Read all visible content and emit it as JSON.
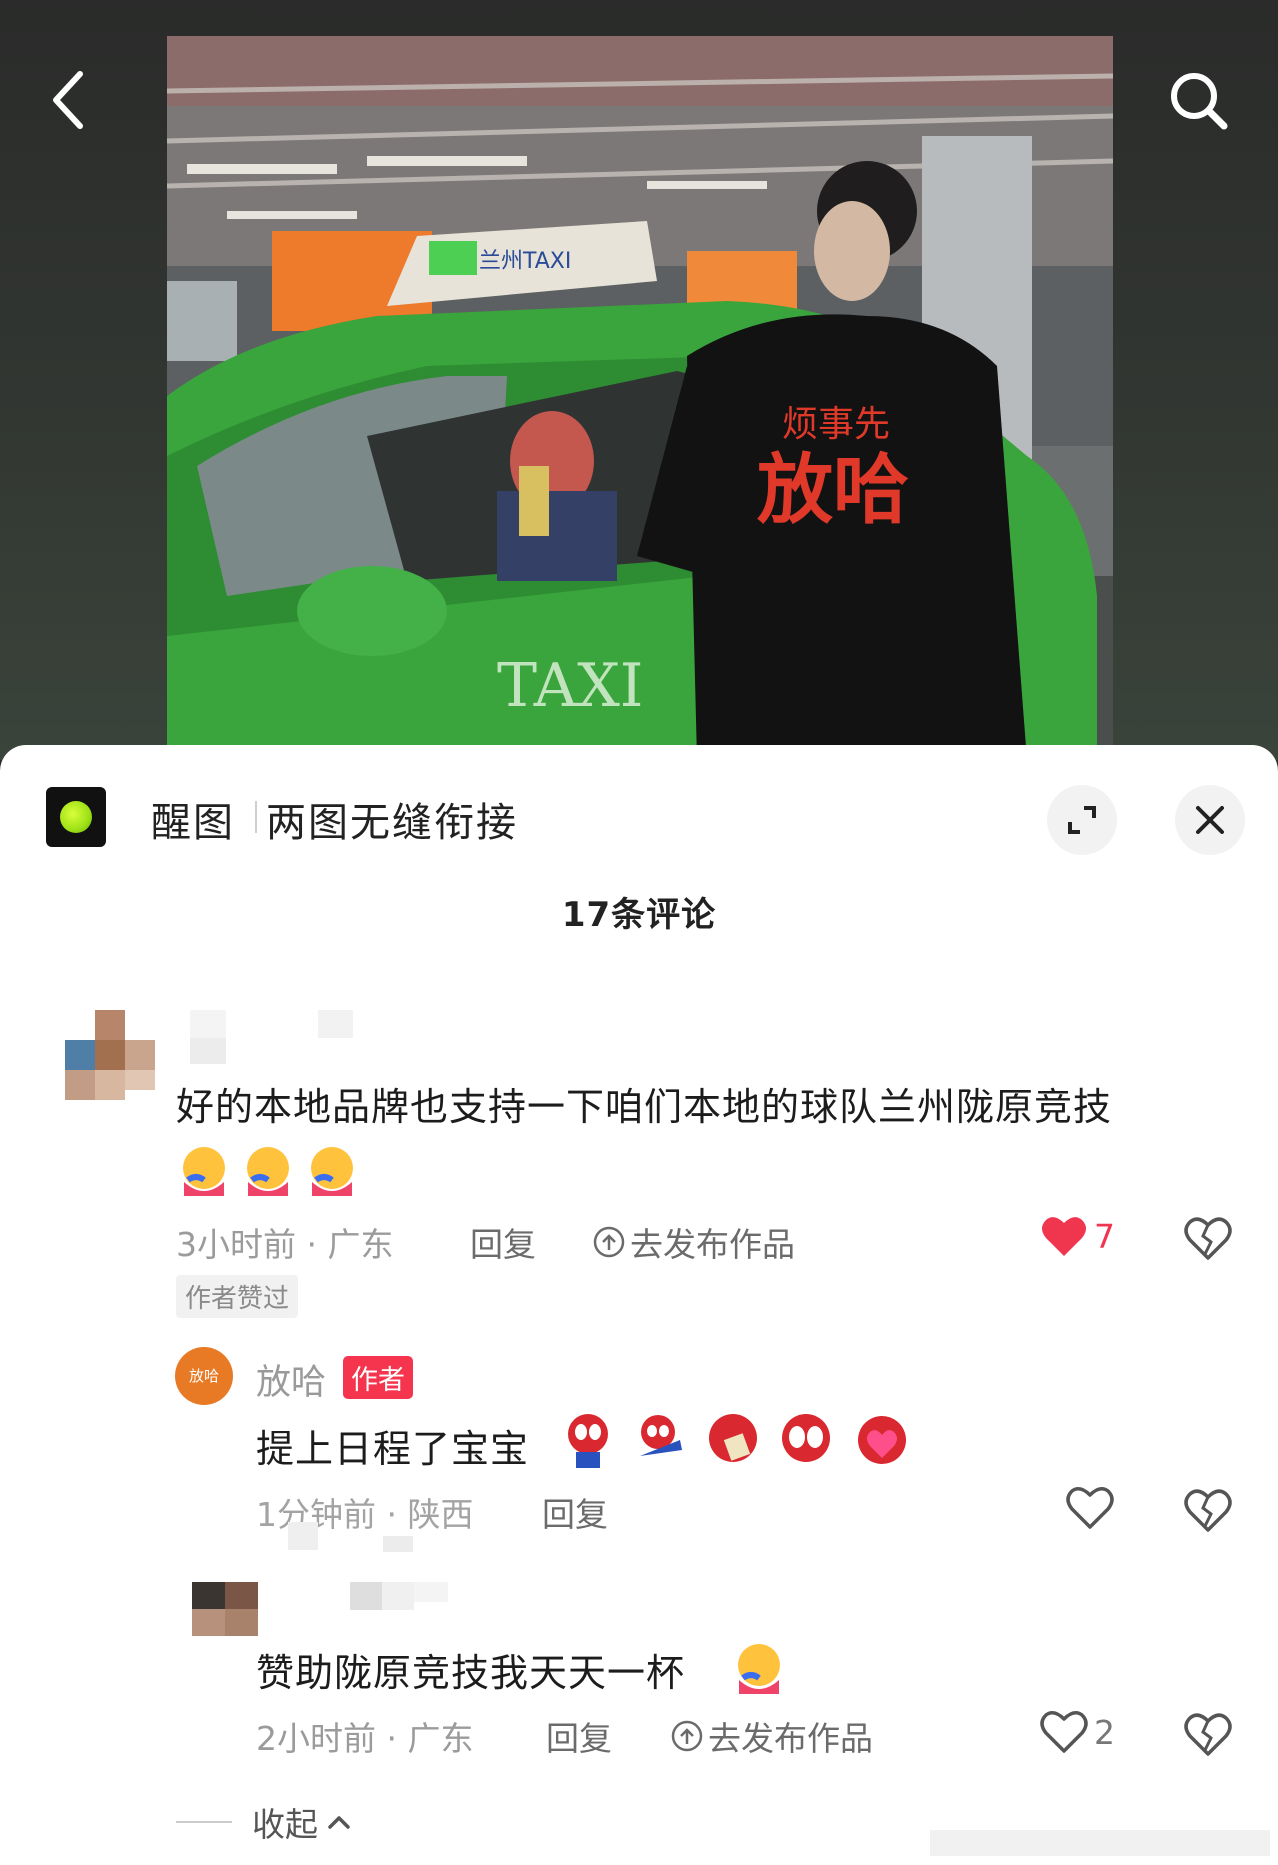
{
  "post": {
    "app_name": "醒图",
    "app_desc": "两图无缝衔接"
  },
  "comments_header": {
    "count_label": "17条评论"
  },
  "comments": [
    {
      "text": "好的本地品牌也支持一下咱们本地的球队兰州陇原竞技",
      "time_loc": "3小时前 · 广东",
      "reply_label": "回复",
      "publish_label": "去发布作品",
      "likes": "7",
      "liked": true,
      "badge": "作者赞过"
    },
    {
      "author": "放哈",
      "author_tag": "作者",
      "avatar_text": "放哈",
      "text": "提上日程了宝宝",
      "time_loc": "1分钟前 · 陕西",
      "reply_label": "回复"
    },
    {
      "text": "赞助陇原竞技我天天一杯",
      "time_loc": "2小时前 · 广东",
      "reply_label": "回复",
      "publish_label": "去发布作品",
      "likes": "2"
    }
  ],
  "collapse_label": "收起",
  "photo": {
    "taxi_sign": "兰州TAXI",
    "taxi_door": "TAXI",
    "shirt_text_1": "烦事先",
    "shirt_text_2": "放哈"
  },
  "colors": {
    "like_red": "#f0354f",
    "author_tag": "#f5354d",
    "taxi_green": "#3aa53c"
  },
  "icons": [
    "back-icon",
    "search-icon",
    "expand-icon",
    "close-icon",
    "heart-icon",
    "broken-heart-icon",
    "upload-icon",
    "chevron-up-icon"
  ]
}
